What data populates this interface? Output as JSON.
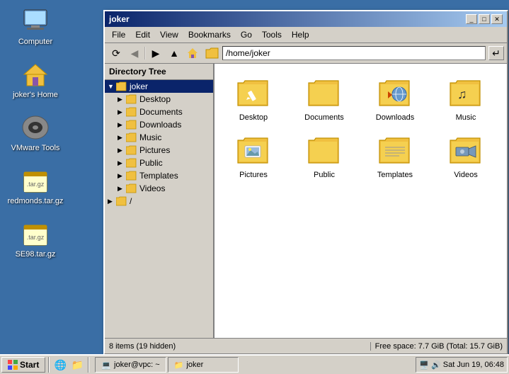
{
  "window": {
    "title": "joker",
    "address": "/home/joker"
  },
  "menu": {
    "items": [
      "File",
      "Edit",
      "View",
      "Bookmarks",
      "Go",
      "Tools",
      "Help"
    ]
  },
  "toolbar": {
    "buttons": [
      "⟳",
      "◀",
      "▶",
      "▲",
      "🏠"
    ],
    "address_label": "/home/joker"
  },
  "left_panel": {
    "header": "Directory Tree",
    "tree": [
      {
        "label": "joker",
        "expanded": true,
        "level": 0,
        "selected": true
      },
      {
        "label": "Desktop",
        "level": 1
      },
      {
        "label": "Documents",
        "level": 1
      },
      {
        "label": "Downloads",
        "level": 1
      },
      {
        "label": "Music",
        "level": 1
      },
      {
        "label": "Pictures",
        "level": 1
      },
      {
        "label": "Public",
        "level": 1
      },
      {
        "label": "Templates",
        "level": 1
      },
      {
        "label": "Videos",
        "level": 1
      },
      {
        "label": "/",
        "level": 0
      }
    ]
  },
  "files": [
    {
      "name": "Desktop",
      "icon": "folder",
      "special": false
    },
    {
      "name": "Documents",
      "icon": "folder",
      "special": false
    },
    {
      "name": "Downloads",
      "icon": "folder-downloads",
      "special": true
    },
    {
      "name": "Music",
      "icon": "folder-music",
      "special": true
    },
    {
      "name": "Pictures",
      "icon": "folder-pictures",
      "special": true
    },
    {
      "name": "Public",
      "icon": "folder",
      "special": false
    },
    {
      "name": "Templates",
      "icon": "folder-templates",
      "special": true
    },
    {
      "name": "Videos",
      "icon": "folder-videos",
      "special": true
    }
  ],
  "status": {
    "left": "8 items (19 hidden)",
    "right": "Free space: 7.7 GiB (Total: 15.7 GiB)"
  },
  "taskbar": {
    "start_label": "Start",
    "apps": [
      {
        "label": "joker@vpc: ~",
        "icon": "💻"
      },
      {
        "label": "joker",
        "icon": "📁"
      }
    ],
    "time": "Sat Jun 19, 06:48"
  },
  "desktop_icons": [
    {
      "label": "Computer",
      "icon": "💻"
    },
    {
      "label": "joker's Home",
      "icon": "🏠"
    },
    {
      "label": "VMware Tools",
      "icon": "💿"
    },
    {
      "label": "redmonds.tar.gz",
      "icon": "📦"
    },
    {
      "label": "SE98.tar.gz",
      "icon": "📦"
    }
  ]
}
